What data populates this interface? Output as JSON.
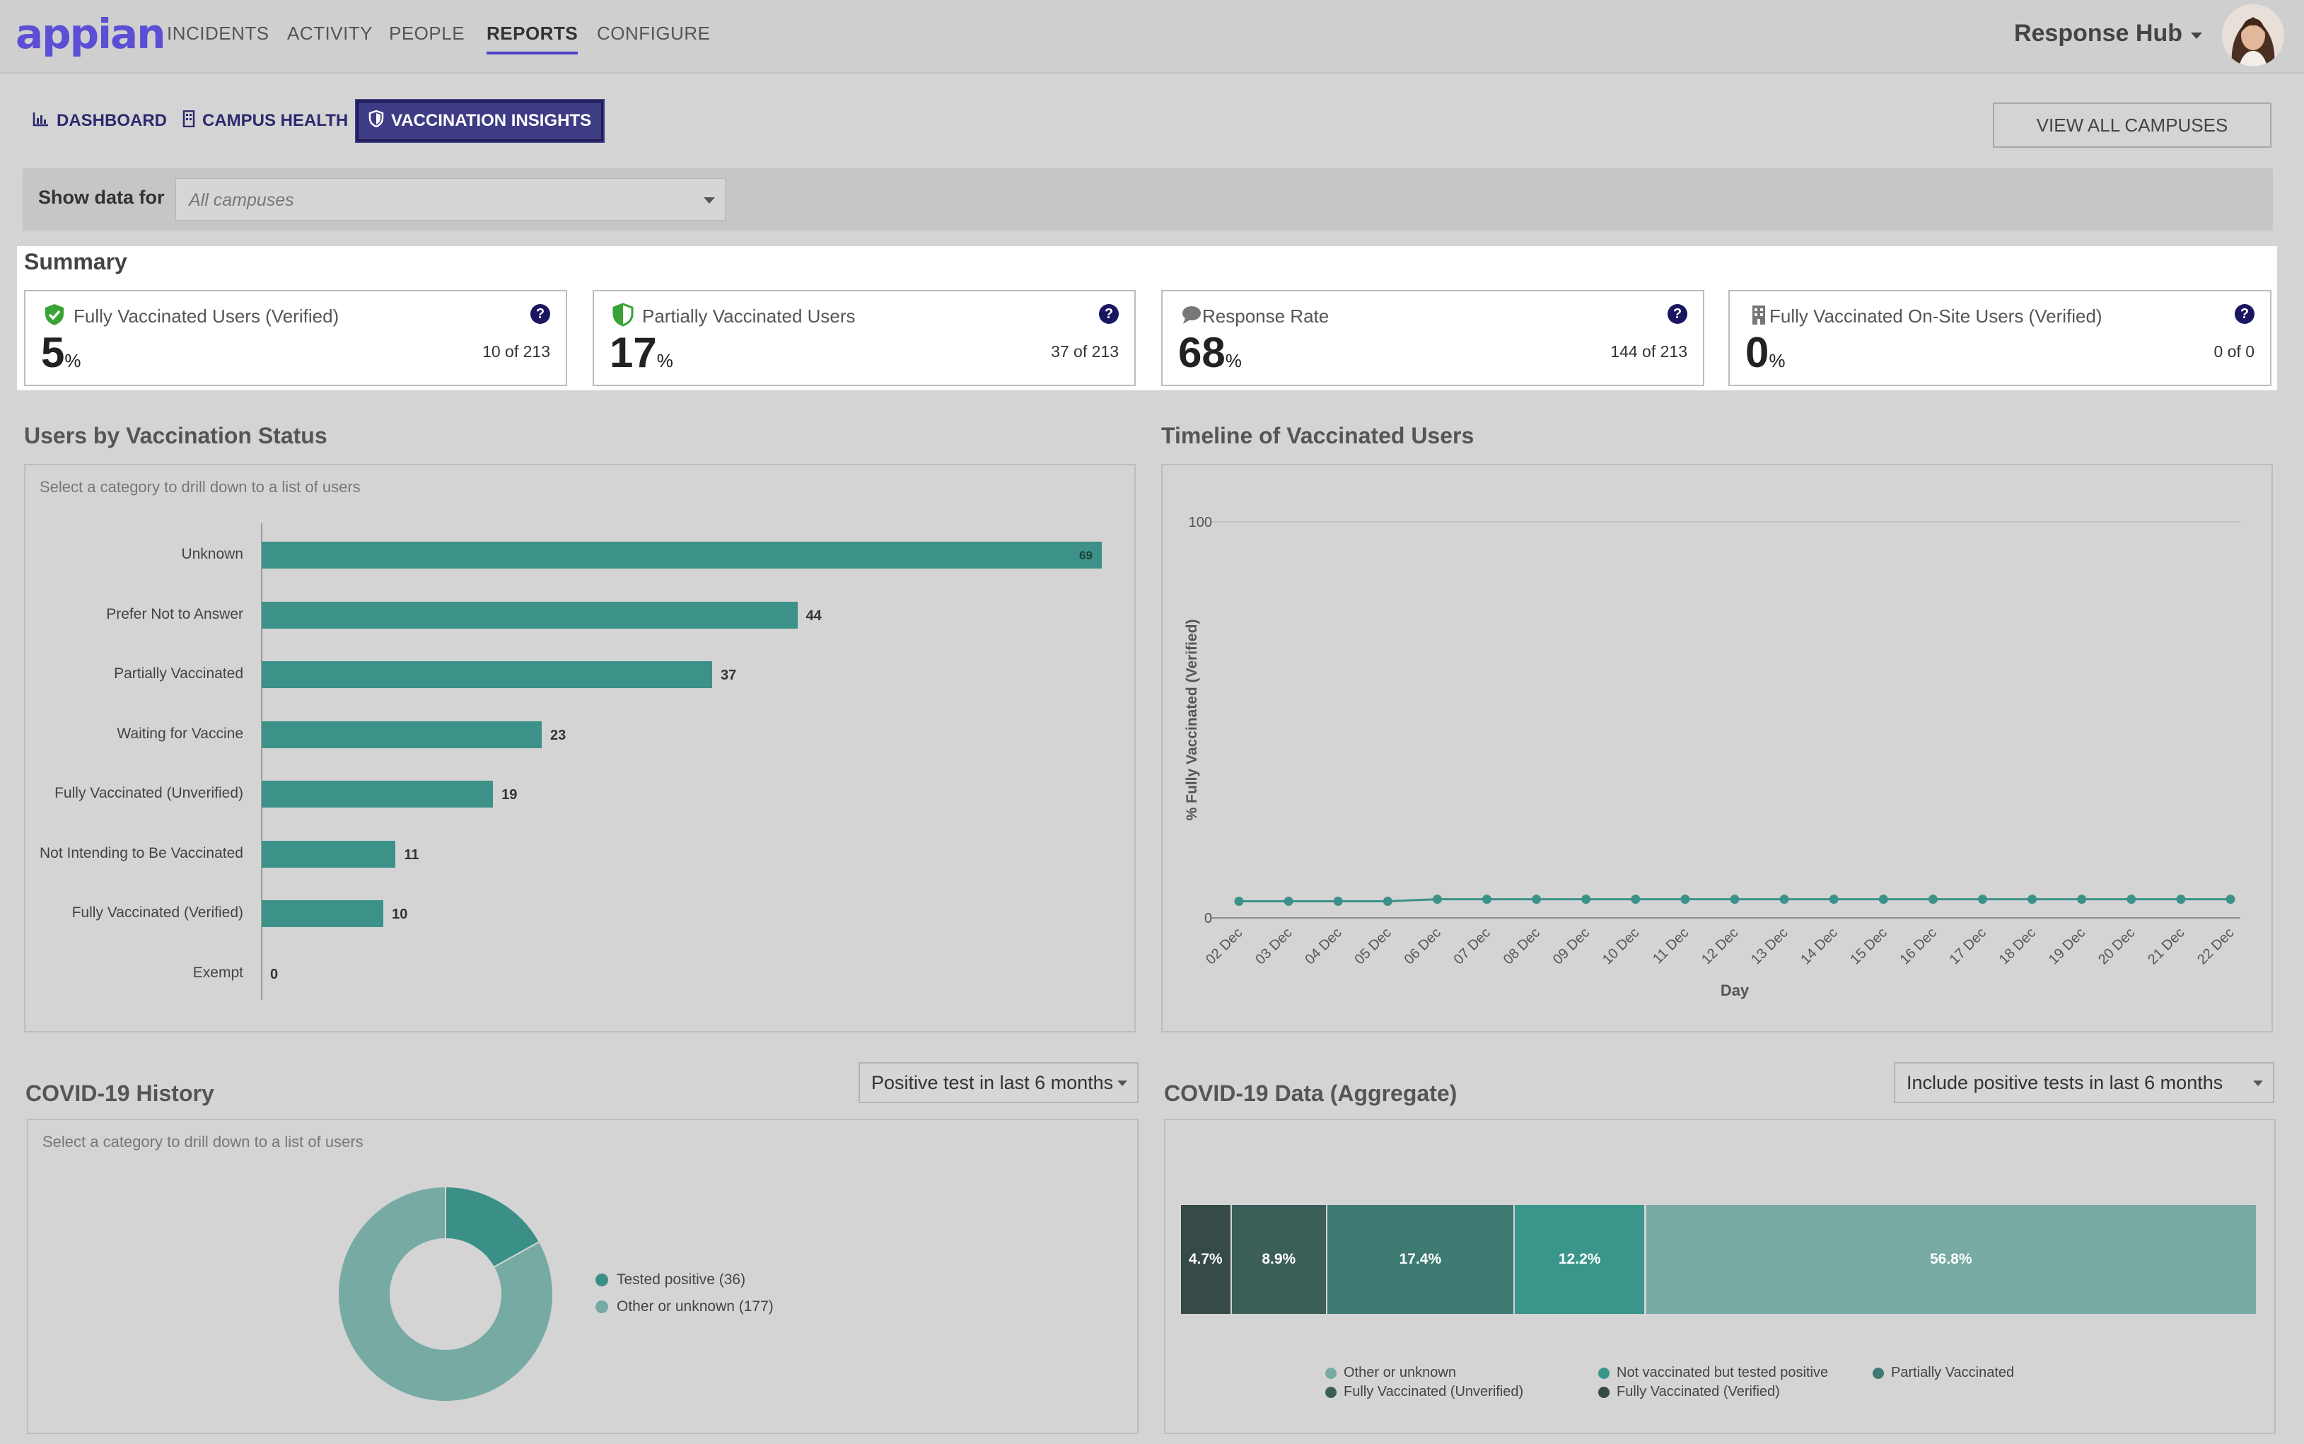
{
  "nav": {
    "logo": "appian",
    "links": [
      "INCIDENTS",
      "ACTIVITY",
      "PEOPLE",
      "REPORTS",
      "CONFIGURE"
    ],
    "active": "REPORTS",
    "hub": "Response Hub"
  },
  "subtabs": [
    {
      "label": "DASHBOARD",
      "icon": "chart-icon"
    },
    {
      "label": "CAMPUS HEALTH",
      "icon": "building-icon"
    },
    {
      "label": "VACCINATION INSIGHTS",
      "icon": "shield-icon"
    }
  ],
  "view_all": "VIEW ALL CAMPUSES",
  "filter": {
    "label": "Show data for",
    "placeholder": "All campuses"
  },
  "summary": {
    "title": "Summary",
    "cards": [
      {
        "title": "Fully Vaccinated Users (Verified)",
        "value": "5",
        "unit": "%",
        "sub": "10 of 213",
        "icon": "shield-check-icon"
      },
      {
        "title": "Partially Vaccinated Users",
        "value": "17",
        "unit": "%",
        "sub": "37 of 213",
        "icon": "half-shield-icon"
      },
      {
        "title": "Response Rate",
        "value": "68",
        "unit": "%",
        "sub": "144 of 213",
        "icon": "comment-icon"
      },
      {
        "title": "Fully Vaccinated On-Site Users (Verified)",
        "value": "0",
        "unit": "%",
        "sub": "0 of 0",
        "icon": "building-icon"
      }
    ]
  },
  "status_section": {
    "title": "Users by Vaccination Status",
    "hint": "Select a category to drill down to a list of users"
  },
  "timeline_section": {
    "title": "Timeline of Vaccinated Users"
  },
  "history_section": {
    "title": "COVID-19 History",
    "hint": "Select a category to drill down to a list of users",
    "dropdown": "Positive test in last 6 months"
  },
  "aggregate_section": {
    "title": "COVID-19 Data (Aggregate)",
    "dropdown": "Include positive tests in last 6 months"
  },
  "chart_data": [
    {
      "type": "bar",
      "orientation": "horizontal",
      "categories": [
        "Unknown",
        "Prefer Not to Answer",
        "Partially Vaccinated",
        "Waiting for Vaccine",
        "Fully Vaccinated (Unverified)",
        "Not Intending to Be Vaccinated",
        "Fully Vaccinated (Verified)",
        "Exempt"
      ],
      "values": [
        69,
        44,
        37,
        23,
        19,
        11,
        10,
        0
      ],
      "color": "#3c9189"
    },
    {
      "type": "line",
      "x": [
        "02 Dec",
        "03 Dec",
        "04 Dec",
        "05 Dec",
        "06 Dec",
        "07 Dec",
        "08 Dec",
        "09 Dec",
        "10 Dec",
        "11 Dec",
        "12 Dec",
        "13 Dec",
        "14 Dec",
        "15 Dec",
        "16 Dec",
        "17 Dec",
        "18 Dec",
        "19 Dec",
        "20 Dec",
        "21 Dec",
        "22 Dec"
      ],
      "values": [
        4.2,
        4.2,
        4.2,
        4.2,
        4.7,
        4.7,
        4.7,
        4.7,
        4.7,
        4.7,
        4.7,
        4.7,
        4.7,
        4.7,
        4.7,
        4.7,
        4.7,
        4.7,
        4.7,
        4.7,
        4.7
      ],
      "xlabel": "Day",
      "ylabel": "% Fully Vaccinated (Verified)",
      "yticks": [
        "0",
        "100"
      ],
      "ylim": [
        0,
        100
      ],
      "grid": true,
      "color": "#3c9189"
    },
    {
      "type": "pie",
      "donut": true,
      "labels": [
        "Tested positive (36)",
        "Other or unknown (177)"
      ],
      "values": [
        36,
        177
      ],
      "colors": [
        "#3a8f86",
        "#76aaa2"
      ],
      "legend": "right"
    },
    {
      "type": "bar",
      "stacked": true,
      "orientation": "horizontal",
      "segments": [
        {
          "label": "4.7%",
          "value": 4.7,
          "color": "#364a47"
        },
        {
          "label": "8.9%",
          "value": 8.9,
          "color": "#3b5e59"
        },
        {
          "label": "17.4%",
          "value": 17.4,
          "color": "#3d7b72"
        },
        {
          "label": "12.2%",
          "value": 12.2,
          "color": "#3a968b"
        },
        {
          "label": "56.8%",
          "value": 56.8,
          "color": "#76aaa2"
        }
      ],
      "legend": [
        {
          "label": "Other or unknown",
          "color": "#76aaa2"
        },
        {
          "label": "Not vaccinated but tested positive",
          "color": "#3a968b"
        },
        {
          "label": "Partially Vaccinated",
          "color": "#3d7b72"
        },
        {
          "label": "Fully Vaccinated (Unverified)",
          "color": "#3b5e59"
        },
        {
          "label": "Fully Vaccinated (Verified)",
          "color": "#364a47"
        }
      ],
      "legend_position": "bottom"
    }
  ]
}
